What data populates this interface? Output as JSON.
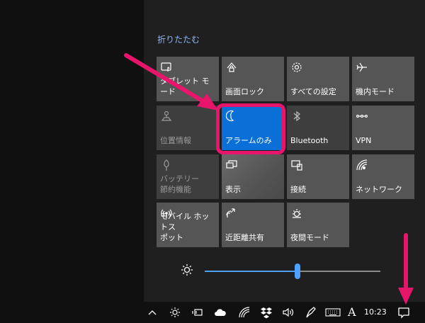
{
  "action_center": {
    "collapse_label": "折りたたむ",
    "tiles": [
      {
        "label": "タブレット モード",
        "icon": "tablet-mode-icon",
        "state": "normal"
      },
      {
        "label": "画面ロック",
        "icon": "rotation-lock-icon",
        "state": "normal"
      },
      {
        "label": "すべての設定",
        "icon": "gear-icon",
        "state": "normal"
      },
      {
        "label": "機内モード",
        "icon": "airplane-icon",
        "state": "normal"
      },
      {
        "label": "位置情報",
        "icon": "location-icon",
        "state": "dim"
      },
      {
        "label": "アラームのみ",
        "icon": "moon-icon",
        "state": "active"
      },
      {
        "label": "Bluetooth",
        "icon": "bluetooth-icon",
        "state": "dim"
      },
      {
        "label": "VPN",
        "icon": "vpn-icon",
        "state": "normal"
      },
      {
        "label": "バッテリー\n節約機能",
        "icon": "battery-saver-icon",
        "state": "dim"
      },
      {
        "label": "表示",
        "icon": "project-display-icon",
        "state": "hover"
      },
      {
        "label": "接続",
        "icon": "connect-icon",
        "state": "normal"
      },
      {
        "label": "ネットワーク",
        "icon": "network-icon",
        "state": "normal"
      },
      {
        "label": "モバイル ホットス\nポット",
        "icon": "mobile-hotspot-icon",
        "state": "normal"
      },
      {
        "label": "近距離共有",
        "icon": "nearby-sharing-icon",
        "state": "normal"
      },
      {
        "label": "夜間モード",
        "icon": "night-light-icon",
        "state": "normal"
      }
    ],
    "brightness": {
      "icon": "brightness-icon",
      "level_percent": 53
    }
  },
  "taskbar": {
    "icons": [
      "chevron-up-icon",
      "brightness-tray-icon",
      "battery-icon",
      "onedrive-cloud-icon",
      "wifi-icon",
      "dropbox-icon",
      "volume-icon",
      "pen-icon",
      "keyboard-icon"
    ],
    "ime_indicator": "A",
    "clock": "10:23",
    "notification_icon": "action-center-icon"
  },
  "annotations": {
    "highlight_color": "#e8166a"
  }
}
